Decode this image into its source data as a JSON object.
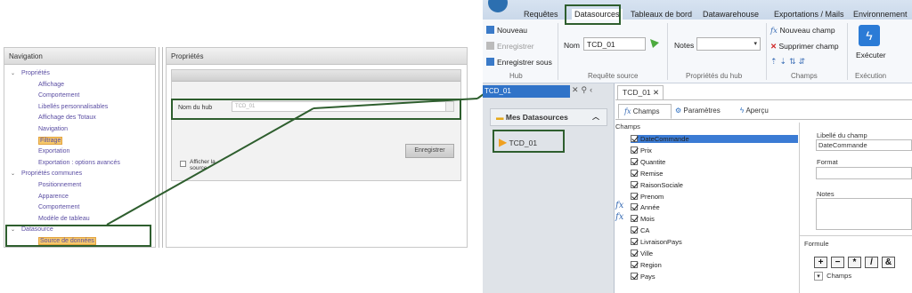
{
  "left": {
    "nav_title": "Navigation",
    "props_title": "Propriétés",
    "tree": [
      {
        "label": "Propriétés",
        "level": 0,
        "caret": true
      },
      {
        "label": "Affichage",
        "level": 1
      },
      {
        "label": "Comportement",
        "level": 1
      },
      {
        "label": "Libellés personnalisables",
        "level": 1
      },
      {
        "label": "Affichage des Totaux",
        "level": 1
      },
      {
        "label": "Navigation",
        "level": 1
      },
      {
        "label": "Filtrage",
        "level": 1,
        "highlight": true
      },
      {
        "label": "Exportation",
        "level": 1
      },
      {
        "label": "Exportation : options avancés",
        "level": 1
      },
      {
        "label": "Propriétés communes",
        "level": 0,
        "caret": true
      },
      {
        "label": "Positionnement",
        "level": 1
      },
      {
        "label": "Apparence",
        "level": 1
      },
      {
        "label": "Comportement",
        "level": 1
      },
      {
        "label": "Modèle de tableau",
        "level": 1
      },
      {
        "label": "Datasource",
        "level": 0,
        "caret": true
      },
      {
        "label": "Source de données",
        "level": 1,
        "highlight": true
      }
    ],
    "hub_label": "Nom du hub",
    "hub_value": "TCD_01",
    "afficher_source": "Afficher la source",
    "save_button": "Enregistrer"
  },
  "right": {
    "menu": [
      "Requêtes",
      "Datasources",
      "Tableaux de bord",
      "Datawarehouse",
      "Exportations / Mails",
      "Environnement"
    ],
    "active_menu": "Datasources",
    "ribbon": {
      "nouveau": "Nouveau",
      "enregistrer": "Enregistrer",
      "enregistrer_sous": "Enregistrer sous",
      "hub_group": "Hub",
      "nom_label": "Nom",
      "nom_value": "TCD_01",
      "requete_group": "Requête source",
      "notes_label": "Notes",
      "props_group": "Propriétés du hub",
      "nouveau_champ": "Nouveau champ",
      "supprimer_champ": "Supprimer champ",
      "champs_group": "Champs",
      "executer": "Exécuter",
      "execution_group": "Exécution"
    },
    "sidebar": {
      "selected": "TCD_01",
      "section_title": "Mes Datasources",
      "item": "TCD_01"
    },
    "doc_tab": "TCD_01",
    "sub_tabs": [
      "Champs",
      "Paramètres",
      "Aperçu"
    ],
    "champs_title": "Champs",
    "fields": [
      {
        "name": "DateCommande",
        "selected": true
      },
      {
        "name": "Prix"
      },
      {
        "name": "Quantite"
      },
      {
        "name": "Remise"
      },
      {
        "name": "RaisonSociale"
      },
      {
        "name": "Prenom"
      },
      {
        "name": "Année",
        "fx": true
      },
      {
        "name": "Mois",
        "fx": true
      },
      {
        "name": "CA"
      },
      {
        "name": "LivraisonPays"
      },
      {
        "name": "Ville"
      },
      {
        "name": "Region"
      },
      {
        "name": "Pays"
      }
    ],
    "libelle_label": "Libellé du champ",
    "libelle_value": "DateCommande",
    "format_label": "Format",
    "notes_label": "Notes",
    "formule_label": "Formule",
    "operators": [
      "+",
      "−",
      "*",
      "/",
      "&"
    ],
    "champs_dropdown": "Champs"
  }
}
